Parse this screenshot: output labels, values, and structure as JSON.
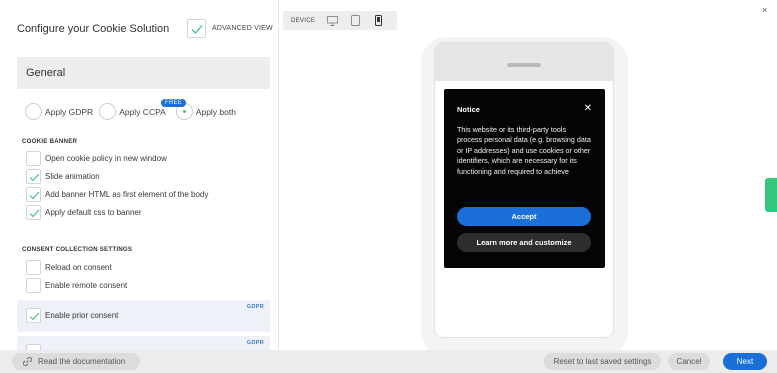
{
  "config": {
    "title": "Configure your Cookie Solution",
    "advanced_view_label": "ADVANCED VIEW",
    "section_general": "General",
    "radio": {
      "apply_gdpr": "Apply GDPR",
      "apply_ccpa": "Apply CCPA",
      "free_badge": "FREE",
      "apply_both": "Apply both",
      "selected": "Apply both"
    },
    "cookie_banner": {
      "heading": "COOKIE BANNER",
      "options": [
        {
          "label": "Open cookie policy in new window",
          "checked": false
        },
        {
          "label": "Slide animation",
          "checked": true
        },
        {
          "label": "Add banner HTML as first element of the body",
          "checked": true
        },
        {
          "label": "Apply default css to banner",
          "checked": true
        }
      ]
    },
    "consent": {
      "heading": "CONSENT COLLECTION SETTINGS",
      "options": [
        {
          "label": "Reload on consent",
          "checked": false
        },
        {
          "label": "Enable remote consent",
          "checked": false
        },
        {
          "label": "Enable prior consent",
          "checked": true,
          "tag": "GDPR"
        },
        {
          "label": "",
          "checked": false,
          "tag": "GDPR"
        }
      ]
    }
  },
  "bottom": {
    "doc_label": "Read the documentation",
    "reset_label": "Reset to last saved settings",
    "cancel_label": "Cancel",
    "next_label": "Next"
  },
  "preview": {
    "device_label": "DEVICE",
    "devices": [
      "desktop-icon",
      "tablet-icon",
      "mobile-icon"
    ],
    "selected_device": "mobile",
    "close_glyph": "×",
    "notice": {
      "title": "Notice",
      "close_glyph": "✕",
      "text": "This website or its third-party tools process personal data (e.g. browsing data or IP addresses) and use cookies or other identifiers, which are necessary for its functioning and required to achieve",
      "accept_label": "Accept",
      "learn_label": "Learn more and customize"
    }
  },
  "colors": {
    "accent_blue": "#1a6fd8",
    "check_green": "#49c08a",
    "notice_bg": "#050505",
    "side_tab_green": "#35c77e"
  }
}
